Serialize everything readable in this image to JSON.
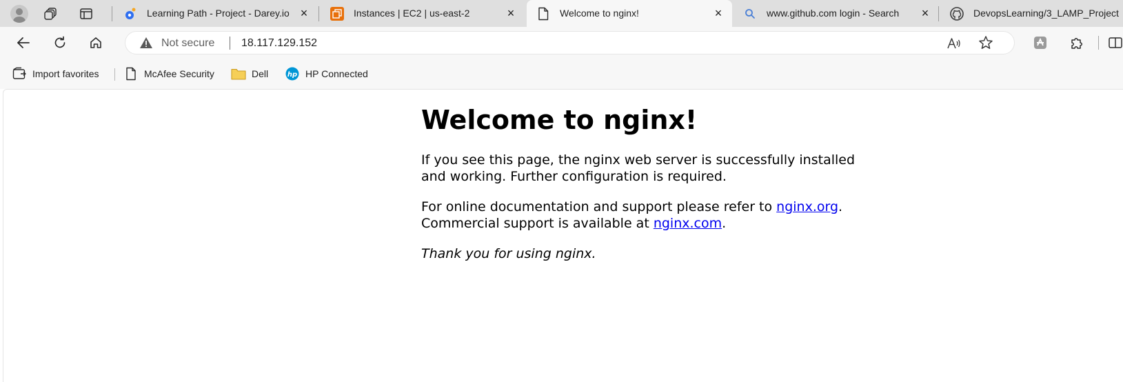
{
  "tabs": [
    {
      "title": "Learning Path - Project - Darey.io",
      "icon": "darey-icon",
      "active": false
    },
    {
      "title": "Instances | EC2 | us-east-2",
      "icon": "aws-ec2-icon",
      "active": false
    },
    {
      "title": "Welcome to nginx!",
      "icon": "document-icon",
      "active": true
    },
    {
      "title": "www.github.com login - Search",
      "icon": "search-icon",
      "active": false
    },
    {
      "title": "DevopsLearning/3_LAMP_Project",
      "icon": "github-icon",
      "active": false
    }
  ],
  "address_bar": {
    "security_label": "Not secure",
    "url": "18.117.129.152"
  },
  "favorites": [
    {
      "label": "Import favorites",
      "icon": "import-favorites-icon"
    },
    {
      "label": "McAfee Security",
      "icon": "document-icon"
    },
    {
      "label": "Dell",
      "icon": "folder-icon"
    },
    {
      "label": "HP Connected",
      "icon": "hp-icon"
    }
  ],
  "content": {
    "heading": "Welcome to nginx!",
    "para1": "If you see this page, the nginx web server is successfully installed and working. Further configuration is required.",
    "para2_prefix": "For online documentation and support please refer to ",
    "link1": "nginx.org",
    "para2_mid": ".",
    "para2_line2": "Commercial support is available at ",
    "link2": "nginx.com",
    "para2_suffix": ".",
    "thanks": "Thank you for using nginx."
  },
  "colors": {
    "link": "#0000ee",
    "tabstrip_bg": "#dfdfdf",
    "toolbar_bg": "#f7f7f7",
    "aws_orange": "#e8700a",
    "darey_blue": "#2f6ff0"
  }
}
